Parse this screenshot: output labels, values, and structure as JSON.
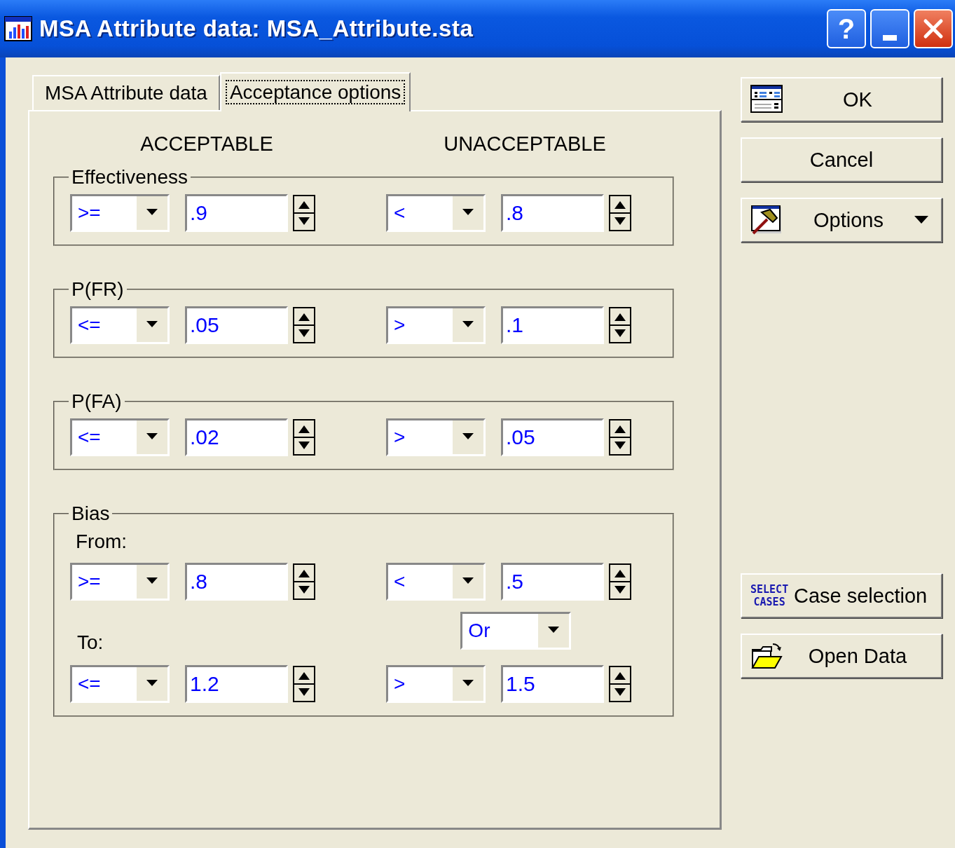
{
  "window": {
    "title": "MSA Attribute data: MSA_Attribute.sta"
  },
  "title_buttons": [
    {
      "kind": "help",
      "text": "?"
    },
    {
      "kind": "minimize"
    },
    {
      "kind": "close"
    }
  ],
  "tabs": [
    {
      "label": "MSA Attribute data",
      "selected": false
    },
    {
      "label": "Acceptance options",
      "selected": true
    }
  ],
  "column_headers": [
    "ACCEPTABLE",
    "UNACCEPTABLE"
  ],
  "groups": [
    {
      "title": "Effectiveness",
      "rows": [
        {
          "kind": "criteria",
          "acceptable": {
            "operator": ">=",
            "value": ".9"
          },
          "unacceptable": {
            "operator": "<",
            "value": ".8"
          }
        }
      ]
    },
    {
      "title": "P(FR)",
      "rows": [
        {
          "kind": "criteria",
          "acceptable": {
            "operator": "<=",
            "value": ".05"
          },
          "unacceptable": {
            "operator": ">",
            "value": ".1"
          }
        }
      ]
    },
    {
      "title": "P(FA)",
      "rows": [
        {
          "kind": "criteria",
          "acceptable": {
            "operator": "<=",
            "value": ".02"
          },
          "unacceptable": {
            "operator": ">",
            "value": ".05"
          }
        }
      ]
    },
    {
      "title": "Bias",
      "rows": [
        {
          "kind": "label",
          "text": "From:"
        },
        {
          "kind": "criteria",
          "acceptable": {
            "operator": ">=",
            "value": ".8"
          },
          "unacceptable": {
            "operator": "<",
            "value": ".5"
          }
        },
        {
          "kind": "join",
          "label": "To:",
          "operator": "Or"
        },
        {
          "kind": "criteria",
          "acceptable": {
            "operator": "<=",
            "value": "1.2"
          },
          "unacceptable": {
            "operator": ">",
            "value": "1.5"
          }
        }
      ]
    }
  ],
  "buttons": [
    {
      "label": "OK",
      "kind": "table",
      "menu": false
    },
    {
      "label": "Cancel",
      "kind": "plain",
      "menu": false
    },
    {
      "label": "Options",
      "kind": "hammer",
      "menu": true
    }
  ],
  "data_buttons": [
    {
      "label": "Case selection",
      "kind": "text",
      "icon_text": [
        "SELECT",
        "CASES"
      ],
      "menu": false
    },
    {
      "label": "Open Data",
      "kind": "folder",
      "menu": false
    }
  ]
}
